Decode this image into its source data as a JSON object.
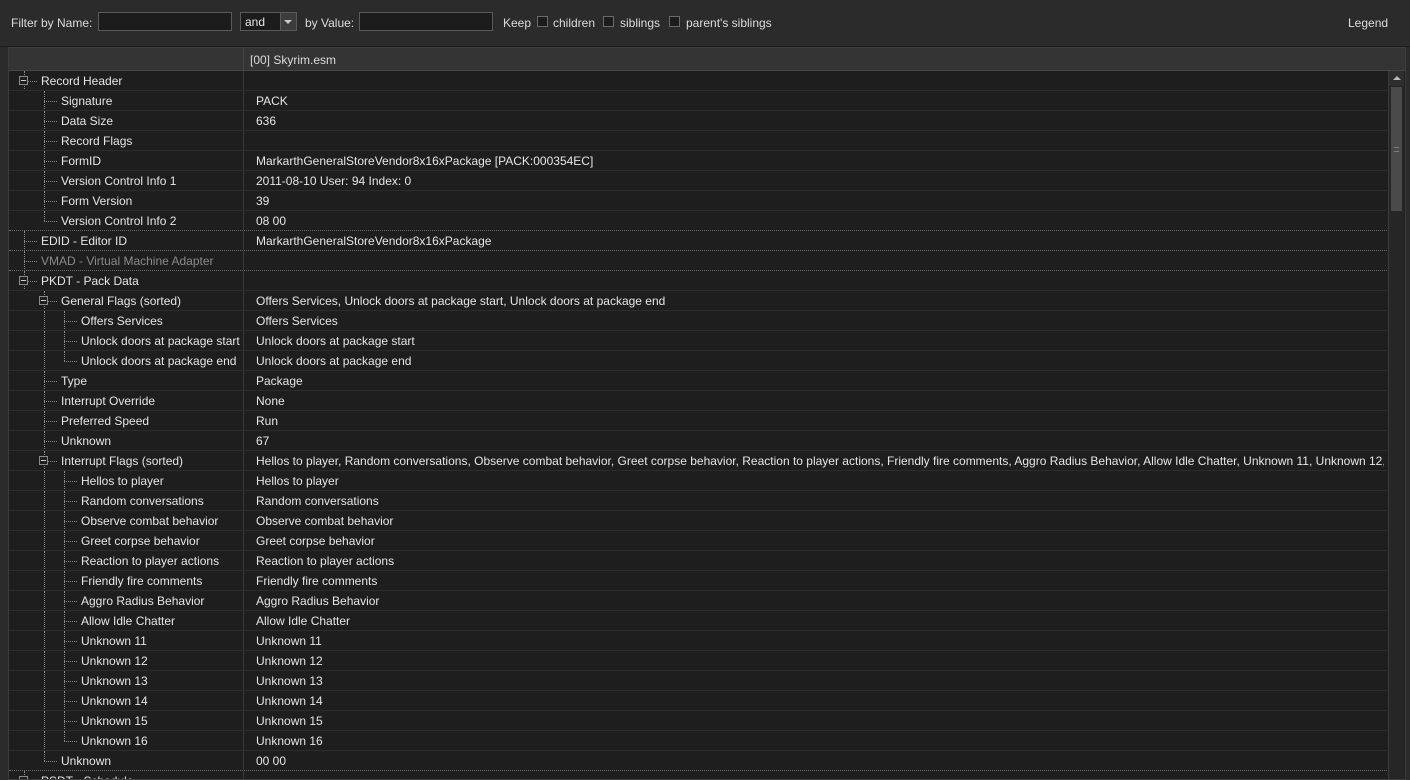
{
  "filter": {
    "name_label": "Filter by Name:",
    "name_value": "",
    "op_value": "and",
    "value_label": "by Value:",
    "value_value": "",
    "keep_label": "Keep",
    "children_label": "children",
    "siblings_label": "siblings",
    "parents_siblings_label": "parent's siblings",
    "legend_label": "Legend"
  },
  "header": {
    "plugin": "[00] Skyrim.esm"
  },
  "rows": [
    {
      "label": "Record Header",
      "value": "",
      "level": 0,
      "exp": true
    },
    {
      "label": "Signature",
      "value": "PACK",
      "level": 1
    },
    {
      "label": "Data Size",
      "value": "636",
      "level": 1
    },
    {
      "label": "Record Flags",
      "value": "",
      "level": 1
    },
    {
      "label": "FormID",
      "value": "MarkarthGeneralStoreVendor8x16xPackage [PACK:000354EC]",
      "level": 1
    },
    {
      "label": "Version Control Info 1",
      "value": "2011-08-10 User: 94 Index: 0",
      "level": 1
    },
    {
      "label": "Form Version",
      "value": "39",
      "level": 1
    },
    {
      "label": "Version Control Info 2",
      "value": "08 00",
      "level": 1,
      "sep": true
    },
    {
      "label": "EDID - Editor ID",
      "value": "MarkarthGeneralStoreVendor8x16xPackage",
      "level": 0,
      "sep": true
    },
    {
      "label": "VMAD - Virtual Machine Adapter",
      "value": "",
      "level": 0,
      "dim": true,
      "sep": true
    },
    {
      "label": "PKDT - Pack Data",
      "value": "",
      "level": 0,
      "exp": true
    },
    {
      "label": "General Flags (sorted)",
      "value": "Offers Services, Unlock doors at package start, Unlock doors at package end",
      "level": 1,
      "exp": true
    },
    {
      "label": "Offers Services",
      "value": "Offers Services",
      "level": 2
    },
    {
      "label": "Unlock doors at package start",
      "value": "Unlock doors at package start",
      "level": 2
    },
    {
      "label": "Unlock doors at package end",
      "value": "Unlock doors at package end",
      "level": 2
    },
    {
      "label": "Type",
      "value": "Package",
      "level": 1
    },
    {
      "label": "Interrupt Override",
      "value": "None",
      "level": 1
    },
    {
      "label": "Preferred Speed",
      "value": "Run",
      "level": 1
    },
    {
      "label": "Unknown",
      "value": "67",
      "level": 1
    },
    {
      "label": "Interrupt Flags (sorted)",
      "value": "Hellos to player, Random conversations, Observe combat behavior, Greet corpse behavior, Reaction to player actions, Friendly fire comments, Aggro Radius Behavior, Allow Idle Chatter, Unknown 11, Unknown 12,...",
      "level": 1,
      "exp": true
    },
    {
      "label": "Hellos to player",
      "value": "Hellos to player",
      "level": 2
    },
    {
      "label": "Random conversations",
      "value": "Random conversations",
      "level": 2
    },
    {
      "label": "Observe combat behavior",
      "value": "Observe combat behavior",
      "level": 2
    },
    {
      "label": "Greet corpse behavior",
      "value": "Greet corpse behavior",
      "level": 2
    },
    {
      "label": "Reaction to player actions",
      "value": "Reaction to player actions",
      "level": 2
    },
    {
      "label": "Friendly fire comments",
      "value": "Friendly fire comments",
      "level": 2
    },
    {
      "label": "Aggro Radius Behavior",
      "value": "Aggro Radius Behavior",
      "level": 2
    },
    {
      "label": "Allow Idle Chatter",
      "value": "Allow Idle Chatter",
      "level": 2
    },
    {
      "label": "Unknown 11",
      "value": "Unknown 11",
      "level": 2
    },
    {
      "label": "Unknown 12",
      "value": "Unknown 12",
      "level": 2
    },
    {
      "label": "Unknown 13",
      "value": "Unknown 13",
      "level": 2
    },
    {
      "label": "Unknown 14",
      "value": "Unknown 14",
      "level": 2
    },
    {
      "label": "Unknown 15",
      "value": "Unknown 15",
      "level": 2
    },
    {
      "label": "Unknown 16",
      "value": "Unknown 16",
      "level": 2
    },
    {
      "label": "Unknown",
      "value": "00 00",
      "level": 1,
      "sep": true
    },
    {
      "label": "PSDT - Schedule",
      "value": "",
      "level": 0,
      "exp": true
    }
  ]
}
